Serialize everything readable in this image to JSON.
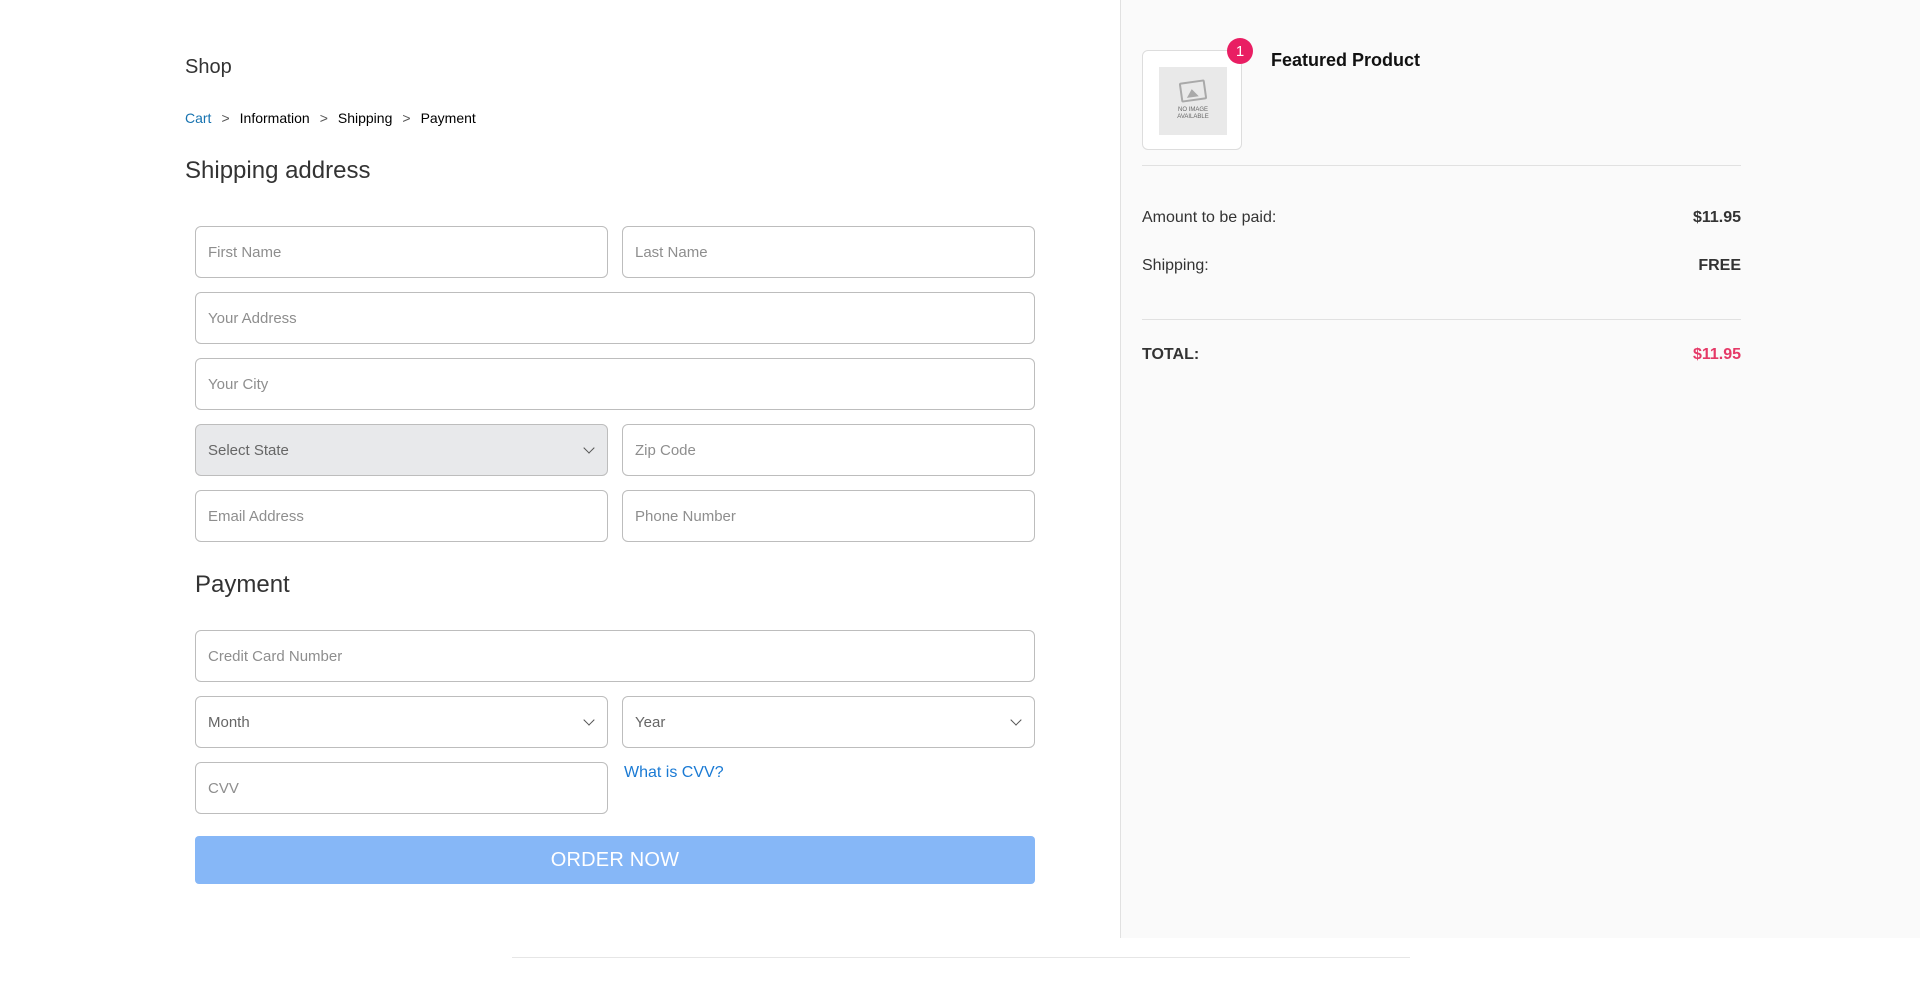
{
  "shop": {
    "title": "Shop"
  },
  "breadcrumb": {
    "items": [
      "Cart",
      "Information",
      "Shipping",
      "Payment"
    ],
    "separator": ">"
  },
  "shipping": {
    "title": "Shipping address",
    "first_name_placeholder": "First Name",
    "last_name_placeholder": "Last Name",
    "address_placeholder": "Your Address",
    "city_placeholder": "Your City",
    "state_selected": "Select State",
    "zip_placeholder": "Zip Code",
    "email_placeholder": "Email Address",
    "phone_placeholder": "Phone Number"
  },
  "payment": {
    "title": "Payment",
    "card_placeholder": "Credit Card Number",
    "month_selected": "Month",
    "year_selected": "Year",
    "cvv_placeholder": "CVV",
    "cvv_link": "What is CVV?",
    "order_button": "ORDER NOW"
  },
  "summary": {
    "product_name": "Featured Product",
    "quantity": "1",
    "image_placeholder_text": "NO IMAGE AVAILABLE",
    "amount_label": "Amount to be paid:",
    "amount_value": "$11.95",
    "shipping_label": "Shipping:",
    "shipping_value": "FREE",
    "total_label": "TOTAL:",
    "total_value": "$11.95"
  },
  "colors": {
    "accent_link": "#1773b0",
    "order_button": "#86b7f7",
    "badge": "#e91e63",
    "total": "#e53967"
  },
  "icons": {
    "select_arrow": "chevron-down-icon",
    "product_image": "no-image-icon"
  }
}
